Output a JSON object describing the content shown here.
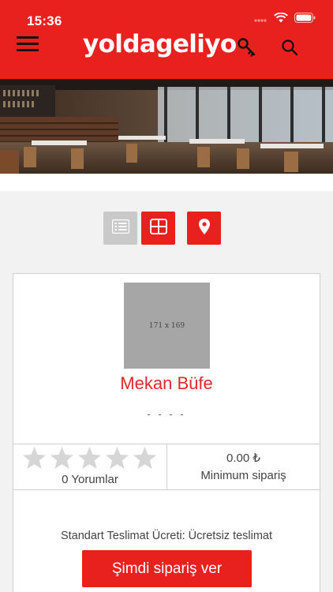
{
  "status_bar": {
    "time": "15:36"
  },
  "header": {
    "logo": "yoldageliyo",
    "menu_icon": "hamburger-menu-icon",
    "key_icon": "key-icon",
    "search_icon": "search-icon"
  },
  "colors": {
    "brand_red": "#e8211f",
    "name_red": "#e0292a",
    "inactive_gray": "#c9c9c9"
  },
  "view_buttons": [
    {
      "name": "list-view",
      "icon": "list-icon",
      "active": false
    },
    {
      "name": "grid-view",
      "icon": "grid-icon",
      "active": true
    },
    {
      "name": "map-view",
      "icon": "map-pin-icon",
      "active": false
    }
  ],
  "venue": {
    "image_placeholder": "171 x 169",
    "name": "Mekan Büfe",
    "subtitle": "- - - -",
    "rating": 0,
    "rating_max": 5,
    "reviews": "0 Yorumlar",
    "min_order_value": "0.00 ₺",
    "min_order_label": "Minimum sipariş",
    "delivery_fee": "Standart Teslimat Ücreti: Ücretsiz teslimat",
    "order_button": "Şimdi sipariş ver"
  }
}
